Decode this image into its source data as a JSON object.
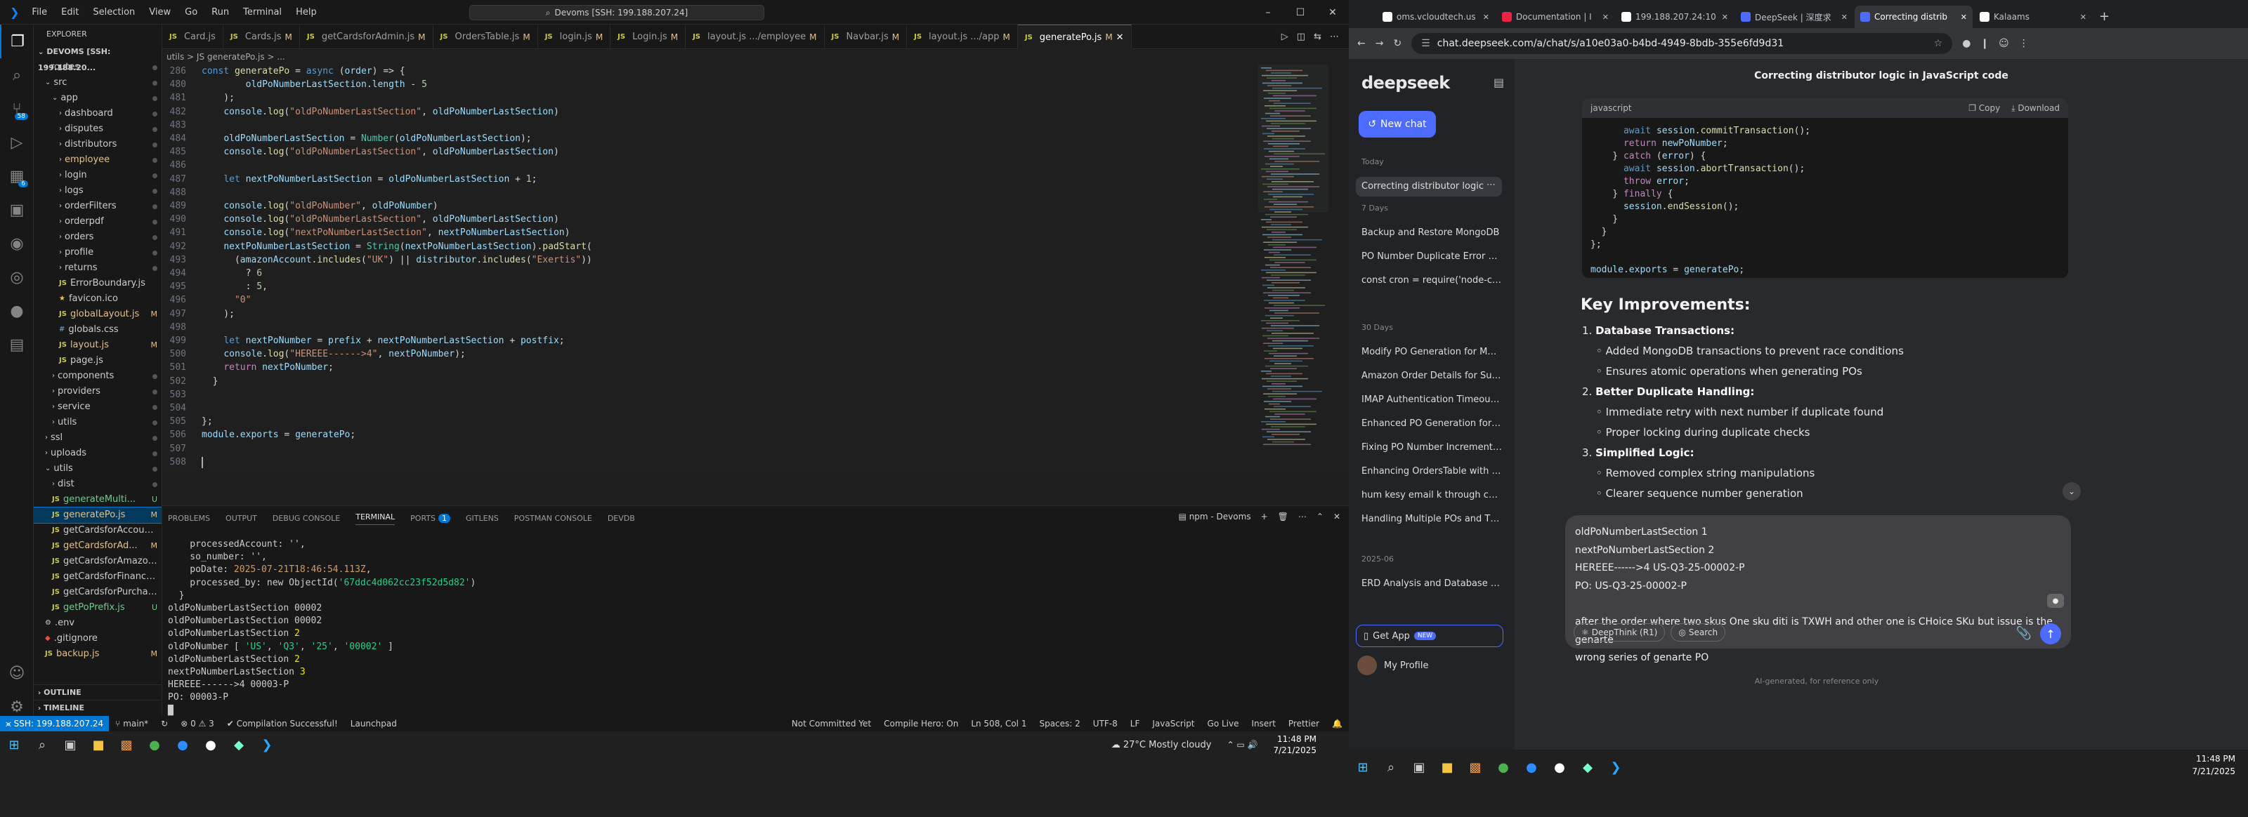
{
  "vscode": {
    "menu": [
      "File",
      "Edit",
      "Selection",
      "View",
      "Go",
      "Run",
      "Terminal",
      "Help"
    ],
    "command_center": "Devoms [SSH: 199.188.207.24]",
    "explorer_title": "EXPLORER",
    "root": "DEVOMS [SSH: 199.188.20...",
    "tree": [
      {
        "label": "routes",
        "kind": "folder",
        "indent": 1,
        "status": ""
      },
      {
        "label": "src",
        "kind": "folder-open",
        "indent": 1,
        "status": ""
      },
      {
        "label": "app",
        "kind": "folder-open",
        "indent": 2,
        "status": ""
      },
      {
        "label": "dashboard",
        "kind": "folder",
        "indent": 3,
        "status": ""
      },
      {
        "label": "disputes",
        "kind": "folder",
        "indent": 3,
        "status": ""
      },
      {
        "label": "distributors",
        "kind": "folder",
        "indent": 3,
        "status": ""
      },
      {
        "label": "employee",
        "kind": "folder",
        "indent": 3,
        "status": "",
        "color": "gM"
      },
      {
        "label": "login",
        "kind": "folder",
        "indent": 3,
        "status": ""
      },
      {
        "label": "logs",
        "kind": "folder",
        "indent": 3,
        "status": ""
      },
      {
        "label": "orderFilters",
        "kind": "folder",
        "indent": 3,
        "status": ""
      },
      {
        "label": "orderpdf",
        "kind": "folder",
        "indent": 3,
        "status": ""
      },
      {
        "label": "orders",
        "kind": "folder",
        "indent": 3,
        "status": ""
      },
      {
        "label": "profile",
        "kind": "folder",
        "indent": 3,
        "status": ""
      },
      {
        "label": "returns",
        "kind": "folder",
        "indent": 3,
        "status": ""
      },
      {
        "label": "ErrorBoundary.js",
        "kind": "js",
        "indent": 3,
        "status": ""
      },
      {
        "label": "favicon.ico",
        "kind": "ico",
        "indent": 3,
        "status": ""
      },
      {
        "label": "globalLayout.js",
        "kind": "js",
        "indent": 3,
        "status": "M",
        "color": "gM"
      },
      {
        "label": "globals.css",
        "kind": "css",
        "indent": 3,
        "status": ""
      },
      {
        "label": "layout.js",
        "kind": "js",
        "indent": 3,
        "status": "M",
        "color": "gM"
      },
      {
        "label": "page.js",
        "kind": "js",
        "indent": 3,
        "status": ""
      },
      {
        "label": "components",
        "kind": "folder",
        "indent": 2,
        "status": ""
      },
      {
        "label": "providers",
        "kind": "folder",
        "indent": 2,
        "status": ""
      },
      {
        "label": "service",
        "kind": "folder",
        "indent": 2,
        "status": ""
      },
      {
        "label": "utils",
        "kind": "folder",
        "indent": 2,
        "status": ""
      },
      {
        "label": "ssl",
        "kind": "folder",
        "indent": 1,
        "status": ""
      },
      {
        "label": "uploads",
        "kind": "folder",
        "indent": 1,
        "status": ""
      },
      {
        "label": "utils",
        "kind": "folder-open",
        "indent": 1,
        "status": ""
      },
      {
        "label": "dist",
        "kind": "folder",
        "indent": 2,
        "status": ""
      },
      {
        "label": "generateMulti...",
        "kind": "js",
        "indent": 2,
        "status": "U",
        "color": "gU"
      },
      {
        "label": "generatePo.js",
        "kind": "js",
        "indent": 2,
        "status": "M",
        "color": "gM",
        "selected": true
      },
      {
        "label": "getCardsforAccount.js",
        "kind": "js",
        "indent": 2,
        "status": ""
      },
      {
        "label": "getCardsforAd...",
        "kind": "js",
        "indent": 2,
        "status": "M",
        "color": "gM"
      },
      {
        "label": "getCardsforAmazon.js",
        "kind": "js",
        "indent": 2,
        "status": ""
      },
      {
        "label": "getCardsforFinance.js",
        "kind": "js",
        "indent": 2,
        "status": ""
      },
      {
        "label": "getCardsforPurchasi...",
        "kind": "js",
        "indent": 2,
        "status": ""
      },
      {
        "label": "getPoPrefix.js",
        "kind": "js",
        "indent": 2,
        "status": "U",
        "color": "gU"
      },
      {
        "label": ".env",
        "kind": "env",
        "indent": 1,
        "status": ""
      },
      {
        "label": ".gitignore",
        "kind": "git",
        "indent": 1,
        "status": ""
      },
      {
        "label": "backup.js",
        "kind": "js",
        "indent": 1,
        "status": "M",
        "color": "gM"
      }
    ],
    "outline": "OUTLINE",
    "timeline": "TIMELINE",
    "tabs": [
      {
        "label": "Card.js",
        "mod": ""
      },
      {
        "label": "Cards.js",
        "mod": "M"
      },
      {
        "label": "getCardsforAdmin.js",
        "mod": "M"
      },
      {
        "label": "OrdersTable.js",
        "mod": "M"
      },
      {
        "label": "login.js",
        "mod": "M"
      },
      {
        "label": "Login.js",
        "mod": "M"
      },
      {
        "label": "layout.js .../employee",
        "mod": "M"
      },
      {
        "label": "Navbar.js",
        "mod": "M"
      },
      {
        "label": "layout.js .../app",
        "mod": "M"
      },
      {
        "label": "generatePo.js",
        "mod": "M",
        "active": true
      }
    ],
    "breadcrumb": "utils > JS generatePo.js > ...",
    "sticky_line": {
      "num": "286",
      "text": "const generatePo = async (order) => {"
    },
    "panel_tabs": [
      "PROBLEMS",
      "OUTPUT",
      "DEBUG CONSOLE",
      "TERMINAL",
      "PORTS",
      "GITLENS",
      "POSTMAN CONSOLE",
      "DEVDB"
    ],
    "ports_count": "1",
    "terminal_label": "npm - Devoms",
    "status": {
      "remote": "SSH: 199.188.207.24",
      "branch": "main*",
      "errors": "0 ⚠ 3",
      "compile": "Compilation Successful!",
      "launchpad": "Launchpad",
      "commit": "Not Committed Yet",
      "hero": "Compile Hero: On",
      "pos": "Ln 508, Col 1",
      "spaces": "Spaces: 2",
      "enc": "UTF-8",
      "eol": "LF",
      "lang": "JavaScript",
      "golive": "Go Live",
      "insert": "Insert",
      "prettier": "Prettier"
    },
    "weather": "27°C Mostly cloudy",
    "time": "11:48 PM",
    "date": "7/21/2025"
  },
  "chrome": {
    "tabs": [
      {
        "label": "oms.vcloudtech.us",
        "color": "#ffffff"
      },
      {
        "label": "Documentation | I",
        "color": "#e24"
      },
      {
        "label": "199.188.207.24:10",
        "color": "#ffffff"
      },
      {
        "label": "DeepSeek | 深度求",
        "color": "#4d6bfe"
      },
      {
        "label": "Correcting distrib",
        "color": "#4d6bfe",
        "active": true
      },
      {
        "label": "Kalaams",
        "color": "#ffffff"
      }
    ],
    "url": "chat.deepseek.com/a/chat/s/a10e03a0-b4bd-4949-8bdb-355e6fd9d31"
  },
  "deepseek": {
    "logo": "deepseek",
    "new_chat": "New chat",
    "groups": {
      "today": "Today",
      "d7": "7 Days",
      "d30": "30 Days",
      "month": "2025-06"
    },
    "history_today": [
      "Correcting distributor logic"
    ],
    "history_7": [
      "Backup and Restore MongoDB",
      "PO Number Duplicate Error Expl",
      "const cron = require('node-cron"
    ],
    "history_30": [
      "Modify PO Generation for Multip",
      "Amazon Order Details for Surge",
      "IMAP Authentication Timeout Er",
      "Enhanced PO Generation for Mu",
      "Fixing PO Number Increment Iss",
      "Enhancing OrdersTable with Pro",
      "hum kesy email k through code",
      "Handling Multiple POs and TXW"
    ],
    "history_month": [
      "ERD Analysis and Database Mod"
    ],
    "get_app": "Get App",
    "new_badge": "NEW",
    "my_profile": "My Profile",
    "chat_title": "Correcting distributor logic in JavaScript code",
    "code_lang": "javascript",
    "copy": "Copy",
    "download": "Download",
    "key_heading": "Key Improvements:",
    "improvements": [
      {
        "n": "1.",
        "title": "Database Transactions:",
        "items": [
          "Added MongoDB transactions to prevent race conditions",
          "Ensures atomic operations when generating POs"
        ]
      },
      {
        "n": "2.",
        "title": "Better Duplicate Handling:",
        "items": [
          "Immediate retry with next number if duplicate found",
          "Proper locking during duplicate checks"
        ]
      },
      {
        "n": "3.",
        "title": "Simplified Logic:",
        "items": [
          "Removed complex string manipulations",
          "Clearer sequence number generation"
        ]
      }
    ],
    "input_lines": [
      "oldPoNumberLastSection 1",
      "nextPoNumberLastSection 2",
      "HEREEE------>4 US-Q3-25-00002-P",
      "PO: US-Q3-25-00002-P",
      "",
      "after the order where two skus One sku diti is TXWH and other one is CHoice SKu but issue is the genarte",
      "wrong series of genarte PO"
    ],
    "deepthink": "DeepThink (R1)",
    "search": "Search",
    "ai_note": "AI-generated, for reference only"
  }
}
